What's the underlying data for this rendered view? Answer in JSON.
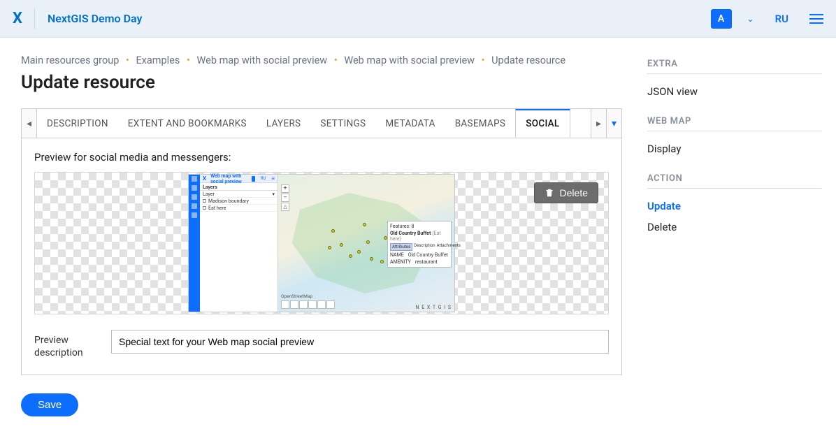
{
  "header": {
    "logo_letter": "X",
    "site_title": "NextGIS Demo Day",
    "user_initial": "A",
    "lang": "RU"
  },
  "breadcrumb": {
    "items": [
      "Main resources group",
      "Examples",
      "Web map with social preview",
      "Web map with social preview",
      "Update resource"
    ]
  },
  "page": {
    "title": "Update resource"
  },
  "tabs": {
    "items": [
      {
        "label": "DESCRIPTION"
      },
      {
        "label": "EXTENT AND BOOKMARKS"
      },
      {
        "label": "LAYERS"
      },
      {
        "label": "SETTINGS"
      },
      {
        "label": "METADATA"
      },
      {
        "label": "BASEMAPS"
      },
      {
        "label": "SOCIAL"
      }
    ],
    "active_index": 6
  },
  "social_panel": {
    "heading": "Preview for social media and messengers:",
    "delete_label": "Delete",
    "desc_label": "Preview description",
    "desc_value": "Special text for your Web map social preview",
    "mini": {
      "title": "Web map with social preview",
      "ru": "RU",
      "layers_header": "Layers",
      "layer_select": "Layer",
      "layer1": "Madison boundary",
      "layer2": "Eat here",
      "osm_label": "OpenStreetMap",
      "features_label": "Features: 8",
      "popup_title": "Old Country Buffet",
      "popup_title_hint": "(Eat here)",
      "tab_attr": "Attributes",
      "tab_desc": "Description",
      "tab_att": "Attachments",
      "k_name": "NAME",
      "v_name": "Old Country Buffet",
      "k_amen": "AMENITY",
      "v_amen": "restaurant",
      "brand": "N E X T G I S"
    }
  },
  "buttons": {
    "save": "Save"
  },
  "sidebar": {
    "extra_heading": "EXTRA",
    "extra_items": [
      "JSON view"
    ],
    "webmap_heading": "WEB MAP",
    "webmap_items": [
      "Display"
    ],
    "action_heading": "ACTION",
    "action_items": [
      "Update",
      "Delete"
    ],
    "action_active": 0
  }
}
